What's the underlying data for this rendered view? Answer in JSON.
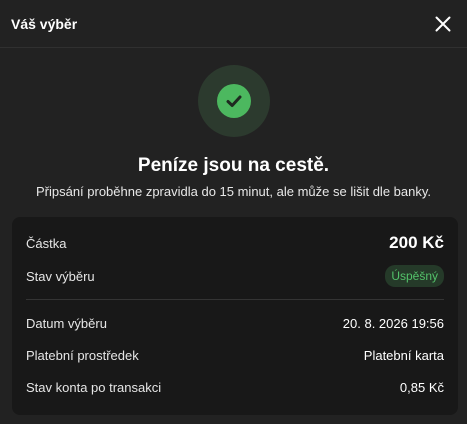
{
  "header": {
    "title": "Váš výběr"
  },
  "hero": {
    "title": "Peníze jsou na cestě.",
    "subtitle": "Připsání proběhne zpravidla do 15 minut, ale může se lišit dle banky."
  },
  "details": {
    "amount_label": "Částka",
    "amount_value": "200 Kč",
    "status_label": "Stav výběru",
    "status_value": "Úspěšný",
    "date_label": "Datum výběru",
    "date_value": "20. 8. 2026 19:56",
    "method_label": "Platební prostředek",
    "method_value": "Platební karta",
    "balance_label": "Stav konta po transakci",
    "balance_value": "0,85 Kč"
  },
  "colors": {
    "success": "#4cb85f",
    "background": "#222222",
    "card": "#181818"
  },
  "icons": {
    "close": "close-icon",
    "success": "check-icon"
  }
}
